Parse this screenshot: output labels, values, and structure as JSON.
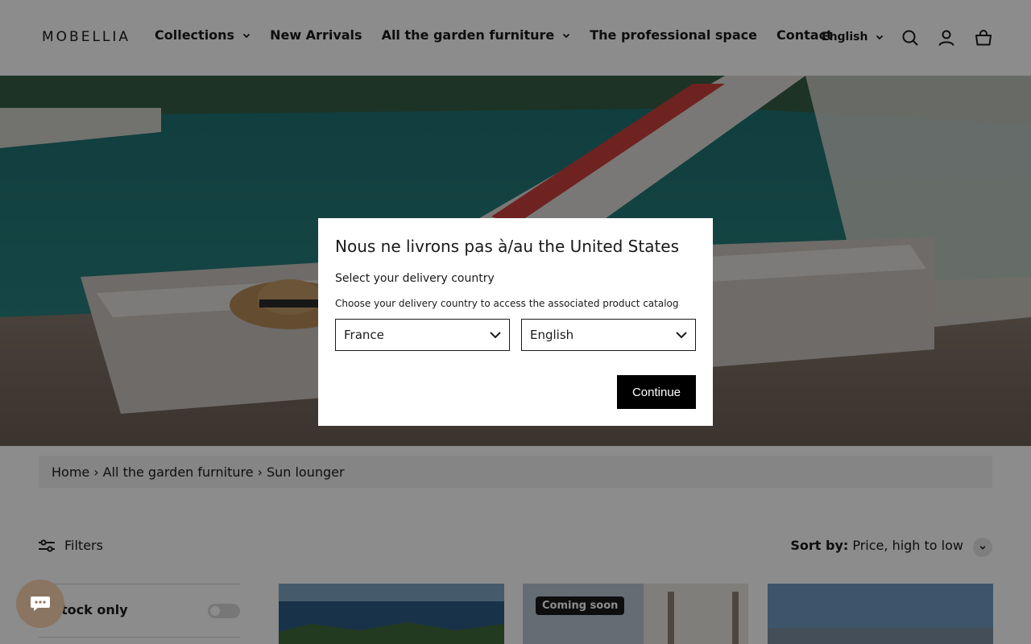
{
  "header": {
    "logo": "MOBELLIA",
    "nav": [
      {
        "label": "Collections",
        "has_dropdown": true
      },
      {
        "label": "New Arrivals",
        "has_dropdown": false
      },
      {
        "label": "All the garden furniture",
        "has_dropdown": true
      },
      {
        "label": "The professional space",
        "has_dropdown": false
      },
      {
        "label": "Contact",
        "has_dropdown": false
      }
    ],
    "language": "English",
    "icons": [
      "search-icon",
      "account-icon",
      "cart-icon"
    ]
  },
  "breadcrumb": {
    "home": "Home",
    "separator": "›",
    "category": "All the garden furniture",
    "current": "Sun lounger"
  },
  "toolbar": {
    "filters_label": "Filters",
    "sort_prefix": "Sort by:",
    "sort_value": "Price, high to low"
  },
  "sidebar": {
    "stock_label": "tock only"
  },
  "products": [
    {
      "badge": ""
    },
    {
      "badge": "Coming soon"
    },
    {
      "badge": ""
    }
  ],
  "modal": {
    "title": "Nous ne livrons pas à/au the United States",
    "subtitle": "Select your delivery country",
    "help": "Choose your delivery country to access the associated product catalog",
    "country": "France",
    "language": "English",
    "continue": "Continue"
  },
  "colors": {
    "accent": "#000000",
    "chat_bubble": "#8a7562",
    "overlay": "rgba(0,0,0,0.45)"
  }
}
